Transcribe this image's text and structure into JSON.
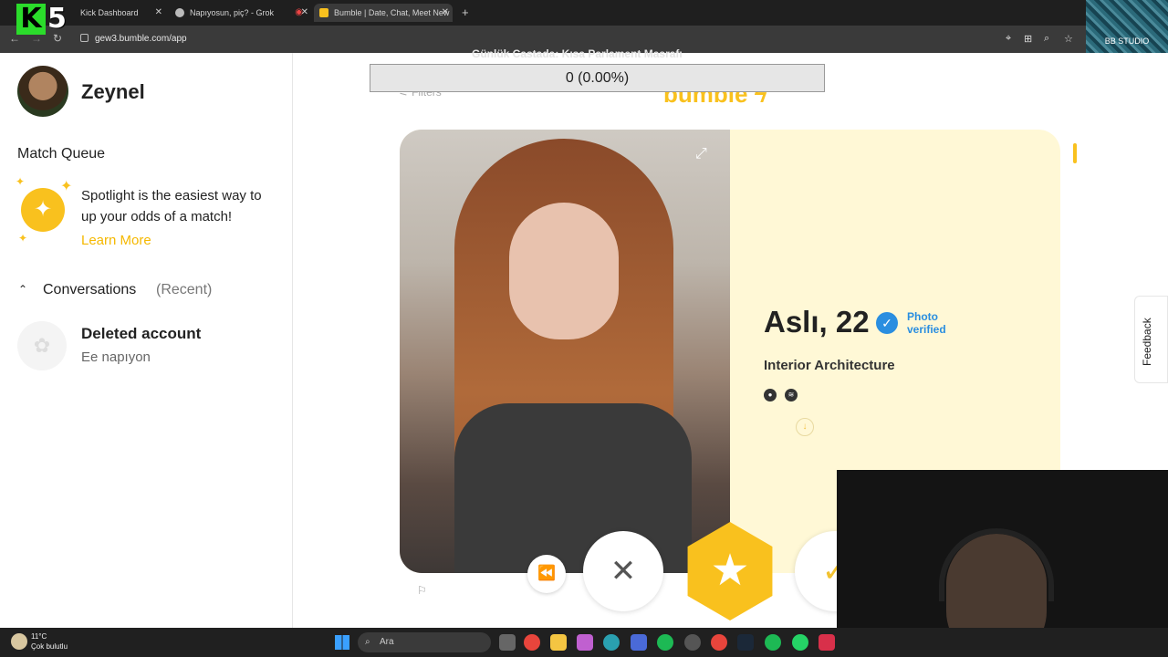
{
  "browser": {
    "tabs": [
      {
        "title": "Kick Dashboard",
        "icon": "kick-icon",
        "active": false
      },
      {
        "title": "Napıyosun, piç? - Grok",
        "icon": "grok-icon",
        "active": false
      },
      {
        "title": "Bumble | Date, Chat, Meet New",
        "icon": "bumble-icon",
        "active": true
      }
    ],
    "url": "gew3.bumble.com/app"
  },
  "overlays": {
    "logo_k": "K",
    "logo_5": "5",
    "bb_studio": "BB STUDIO",
    "ticker": "Günlük Castada: Kısa Parlament Masrafı",
    "progress": "0 (0.00%)"
  },
  "sidebar": {
    "username": "Zeynel",
    "match_queue_title": "Match Queue",
    "spotlight_text": "Spotlight is the easiest way to up your odds of a match!",
    "learn_more": "Learn More",
    "conversations_title": "Conversations",
    "conversations_recent": "(Recent)",
    "conversation": {
      "name": "Deleted account",
      "message": "Ee napıyon"
    }
  },
  "main": {
    "filters": "Filters",
    "logo": "bumble",
    "profile": {
      "name_age": "Aslı, 22",
      "verified": "Photo verified",
      "profession": "Interior Architecture"
    },
    "feedback": "Feedback"
  },
  "taskbar": {
    "temp": "11°C",
    "weather": "Çok bulutlu",
    "search_placeholder": "Ara"
  },
  "colors": {
    "accent": "#f9c11e",
    "verified_blue": "#2a8ee0",
    "card_bg": "#fff8d6"
  }
}
